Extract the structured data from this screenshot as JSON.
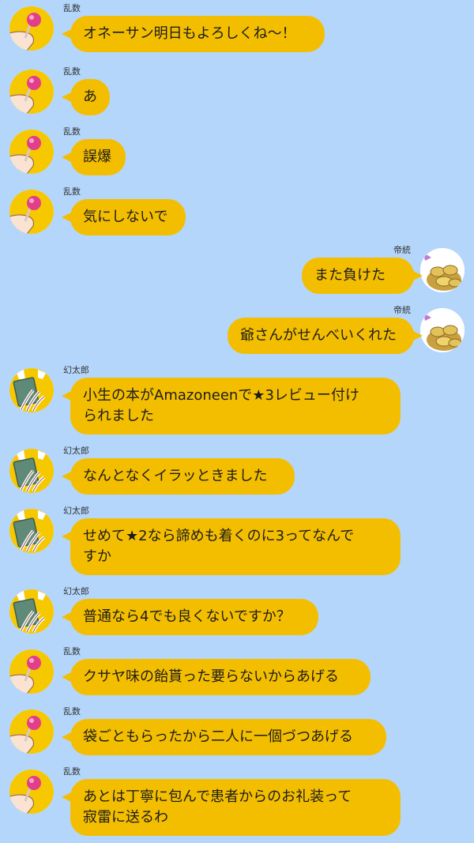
{
  "colors": {
    "background": "#b4d6fb",
    "bubble": "#f4be00",
    "text": "#1c1c1c"
  },
  "messages": [
    {
      "side": "left",
      "avatar": "ranpo-avatar-icon",
      "name": "乱数",
      "text": "オネーサン明日もよろしくね～！"
    },
    {
      "side": "left",
      "avatar": "ranpo-avatar-icon",
      "name": "乱数",
      "text": "あ"
    },
    {
      "side": "left",
      "avatar": "ranpo-avatar-icon",
      "name": "乱数",
      "text": "誤爆"
    },
    {
      "side": "left",
      "avatar": "ranpo-avatar-icon",
      "name": "乱数",
      "text": "気にしないで"
    },
    {
      "side": "right",
      "avatar": "coins-avatar-icon",
      "name": "帝統",
      "text": "また負けた"
    },
    {
      "side": "right",
      "avatar": "coins-avatar-icon",
      "name": "帝統",
      "text": "爺さんがせんべいくれた"
    },
    {
      "side": "left",
      "avatar": "book-avatar-icon",
      "name": "幻太郎",
      "text": "小生の本がAmazoneenで★3レビュー付け\nられました"
    },
    {
      "side": "left",
      "avatar": "book-avatar-icon",
      "name": "幻太郎",
      "text": "なんとなくイラッときました"
    },
    {
      "side": "left",
      "avatar": "book-avatar-icon",
      "name": "幻太郎",
      "text": "せめて★2なら諦めも着くのに3ってなんで\nすか"
    },
    {
      "side": "left",
      "avatar": "book-avatar-icon",
      "name": "幻太郎",
      "text": "普通なら4でも良くないですか？"
    },
    {
      "side": "left",
      "avatar": "ranpo-avatar-icon",
      "name": "乱数",
      "text": "クサヤ味の飴貰った要らないからあげる"
    },
    {
      "side": "left",
      "avatar": "ranpo-avatar-icon",
      "name": "乱数",
      "text": "袋ごともらったから二人に一個づつあげる"
    },
    {
      "side": "left",
      "avatar": "ranpo-avatar-icon",
      "name": "乱数",
      "text": "あとは丁寧に包んで患者からのお礼装って\n寂雷に送るわ"
    }
  ]
}
